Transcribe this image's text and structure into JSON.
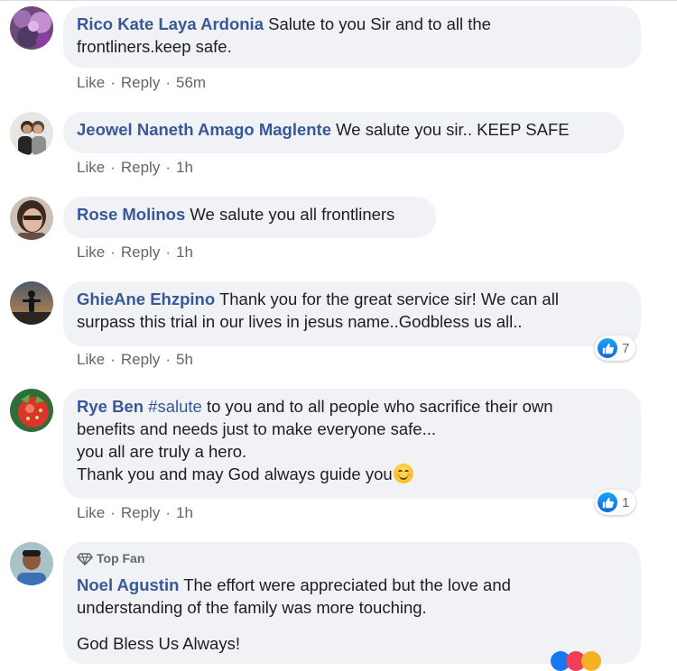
{
  "comments": [
    {
      "author": "Rico Kate Laya Ardonia",
      "text_lines": [
        "Salute to you Sir and to all the",
        "frontliners.keep safe."
      ],
      "like": "Like",
      "reply": "Reply",
      "time": "56m"
    },
    {
      "author": "Jeowel Naneth Amago Maglente",
      "text_lines": [
        "We salute you sir.. KEEP SAFE"
      ],
      "like": "Like",
      "reply": "Reply",
      "time": "1h"
    },
    {
      "author": "Rose Molinos",
      "text_lines": [
        "We salute you all frontliners"
      ],
      "like": "Like",
      "reply": "Reply",
      "time": "1h"
    },
    {
      "author": "GhieAne Ehzpino",
      "text_lines": [
        "Thank you for the great service sir! We can all",
        "surpass this trial in our lives in jesus name..Godbless us all.."
      ],
      "like": "Like",
      "reply": "Reply",
      "time": "5h",
      "reaction_count": "7"
    },
    {
      "author": "Rye Ben",
      "hashtag": "#salute",
      "text_lines": [
        "to you and to all people who sacrifice their own",
        "benefits and needs just to make everyone safe...",
        "you all are truly a hero.",
        "Thank you and may God always guide you"
      ],
      "like": "Like",
      "reply": "Reply",
      "time": "1h",
      "reaction_count": "1"
    },
    {
      "badge": "Top Fan",
      "author": "Noel Agustin",
      "text_lines": [
        "The effort were appreciated but the love and",
        "understanding of the family was more touching.",
        "God Bless Us Always!"
      ]
    }
  ],
  "separator": "·",
  "colors": {
    "link": "#385898",
    "bubble": "#f0f2f5",
    "meta": "#606770",
    "like_blue": "#1877f2"
  },
  "icons": {
    "like_reaction": "thumbs-up-icon",
    "top_fan": "diamond-icon",
    "emoji": "smiling-face-icon"
  }
}
